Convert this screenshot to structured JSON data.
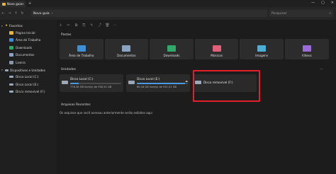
{
  "window": {
    "tab_title": "Novo guia",
    "close_glyph": "✕",
    "add_glyph": "+",
    "controls": [
      "—",
      "▢",
      "✕"
    ]
  },
  "navbar": {
    "back": "←",
    "forward": "→",
    "up": "↑",
    "refresh": "↻",
    "address_text": "Novo guia",
    "address_chevron": "›",
    "search_placeholder": "Pesquisar",
    "search_glyph": "⌕"
  },
  "sidebar": {
    "favorites_label": "Favoritos",
    "favorites": [
      {
        "label": "Página Inicial",
        "color": "#e8b43a"
      },
      {
        "label": "Área de Trabalho",
        "color": "#3f8fd6"
      },
      {
        "label": "Downloads",
        "color": "#2fa86a"
      },
      {
        "label": "Documentos",
        "color": "#8aa3c0"
      },
      {
        "label": "Lixeira",
        "color": "#8b95a3"
      }
    ],
    "devices_label": "Dispositivos e Unidades",
    "devices": [
      {
        "label": "Disco Local (C:)"
      },
      {
        "label": "Disco Local (E:)"
      },
      {
        "label": "Disco removível (F:)"
      }
    ]
  },
  "toolbar": {
    "buttons": [
      "＋",
      "✂",
      "⧉",
      "⎘",
      "✎",
      "⤴",
      "🗑",
      "⋯"
    ]
  },
  "main": {
    "folders_title": "Pastas",
    "folders": [
      {
        "label": "Área de Trabalho",
        "color": "#3f8fd6"
      },
      {
        "label": "Documentos",
        "color": "#8aa3c0"
      },
      {
        "label": "Downloads",
        "color": "#2fa86a"
      },
      {
        "label": "Músicas",
        "color": "#e0607a"
      },
      {
        "label": "Imagens",
        "color": "#4ab0d9"
      },
      {
        "label": "Vídeos",
        "color": "#9a6ad9"
      }
    ],
    "drives_title": "Unidades",
    "more_glyph": "⋯",
    "drives": [
      {
        "name": "Disco Local (C:)",
        "info": "778,38 GB livre(s) de 930,51 GB",
        "used_fraction": 0.16
      },
      {
        "name": "Disco Local (E:)",
        "info": "60,18 GB livre(s) de 931,51 GB",
        "used_fraction": 0.94,
        "eject": "⏏"
      },
      {
        "name": "Disco removível (F:)",
        "info": "",
        "used_fraction": 0
      }
    ],
    "recent_title": "Arquivos Recentes",
    "recent_empty": "Os arquivos que você acessou anteriormente serão exibidos aqui"
  },
  "colors": {
    "highlight": "#e0202a",
    "bar_fill": "#4a9ae0"
  }
}
